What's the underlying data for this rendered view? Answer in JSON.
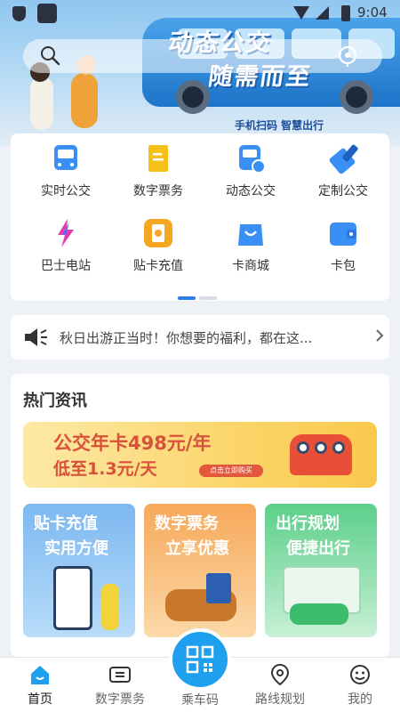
{
  "status_bar": {
    "time": "9:04"
  },
  "banner": {
    "headline_1": "动态公交",
    "headline_2": "随需而至",
    "subline": "手机扫码  智慧出行"
  },
  "functions": [
    {
      "label": "实时公交",
      "icon": "bus-icon"
    },
    {
      "label": "数字票务",
      "icon": "ticket-icon"
    },
    {
      "label": "动态公交",
      "icon": "dynamic-bus-icon"
    },
    {
      "label": "定制公交",
      "icon": "custom-bus-icon"
    },
    {
      "label": "巴士电站",
      "icon": "lightning-icon"
    },
    {
      "label": "贴卡充值",
      "icon": "card-recharge-icon"
    },
    {
      "label": "卡商城",
      "icon": "shopping-bag-icon"
    },
    {
      "label": "卡包",
      "icon": "wallet-icon"
    }
  ],
  "notice": {
    "text": "秋日出游正当时！你想要的福利，都在这..."
  },
  "news": {
    "title": "热门资讯",
    "promo": {
      "line1": "公交年卡498元/年",
      "line2": "低至1.3元/天",
      "button": "点击立即购买"
    },
    "tiles": [
      {
        "line1": "贴卡充值",
        "line2": "实用方便"
      },
      {
        "line1": "数字票务",
        "line2": "立享优惠"
      },
      {
        "line1": "出行规划",
        "line2": "便捷出行"
      }
    ]
  },
  "bottom_nav": [
    {
      "label": "首页",
      "icon": "home-icon",
      "active": true
    },
    {
      "label": "数字票务",
      "icon": "ticket-icon"
    },
    {
      "label": "乘车码",
      "icon": "qr-code-icon"
    },
    {
      "label": "路线规划",
      "icon": "location-pin-icon"
    },
    {
      "label": "我的",
      "icon": "profile-icon"
    }
  ],
  "colors": {
    "accent": "#1ea0ef",
    "icon_blue": "#3a8ff5",
    "icon_yellow": "#f6c21a",
    "icon_orange": "#f5a623",
    "nav_active": "#1a1a1a"
  }
}
